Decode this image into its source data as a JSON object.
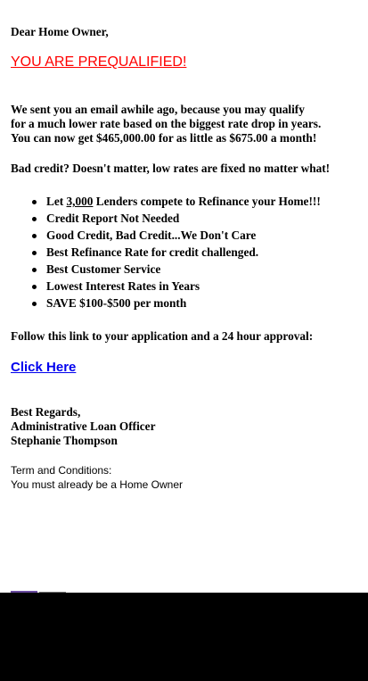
{
  "greeting": "Dear Home Owner,",
  "headline": "YOU ARE PREQUALIFIED!",
  "intro_lines": [
    "We sent you an email awhile ago, because you may qualify",
    "for a much lower rate based on the biggest rate drop in years.",
    "You can now get $465,000.00 for as little as $675.00 a month!"
  ],
  "bad_credit": "Bad credit? Doesn't matter, low rates are fixed no matter what!",
  "bullets": {
    "item1_prefix": "Let ",
    "item1_number": "3,000",
    "item1_suffix": " Lenders compete to Refinance your Home!!!",
    "item2": "Credit Report Not Needed",
    "item3": "Good Credit, Bad Credit...We Don't Care",
    "item4": "Best Refinance Rate for credit challenged.",
    "item5": "Best Customer Service",
    "item6": "Lowest Interest Rates in Years",
    "item7": "SAVE $100-$500 per month"
  },
  "follow_text": "Follow this link to your application and a 24 hour approval:",
  "link_label": "Click Here",
  "signature": {
    "line1": "Best Regards,",
    "line2": "Administrative Loan Officer",
    "line3": "Stephanie Thompson"
  },
  "terms": {
    "line1": "Term and Conditions:",
    "line2": "You must already be a Home Owner"
  },
  "colors": {
    "headline": "#ff0000",
    "link": "#0000ee",
    "bottom_bar": "#000000"
  }
}
